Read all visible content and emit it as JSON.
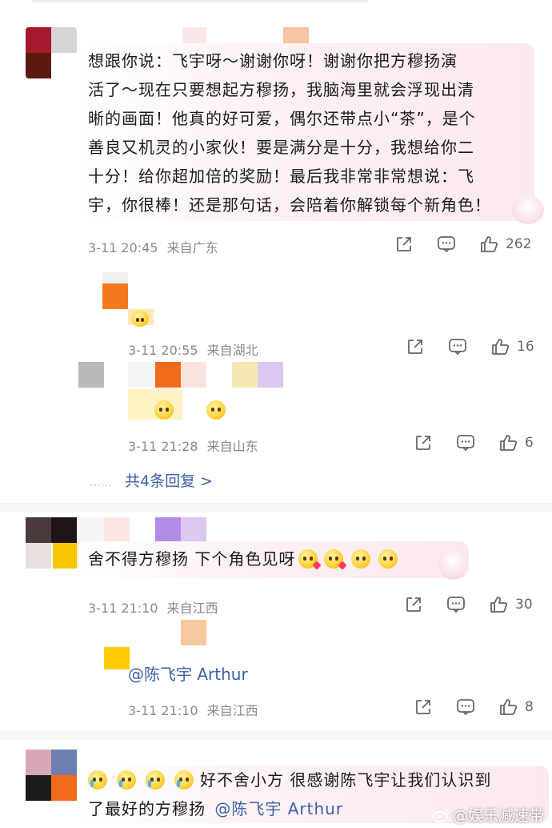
{
  "comment1": {
    "text": "想跟你说：飞宇呀～谢谢你呀！谢谢你把方穆扬演活了～现在只要想起方穆扬，我脑海里就会浮现出清晰的画面！他真的好可爱，偶尔还带点小“茶”，是个善良又机灵的小家伙！要是满分是十分，我想给你二十分！给你超加倍的奖励！最后我非常非常想说：飞宇，你很棒！还是那句话，会陪着你解锁每个新角色！",
    "lines": [
      "想跟你说：飞宇呀～谢谢你呀！谢谢你把方穆扬演",
      "活了～现在只要想起方穆扬，我脑海里就会浮现出清",
      "晰的画面！他真的好可爱，偶尔还带点小“茶”，是个",
      "善良又机灵的小家伙！要是满分是十分，我想给你二",
      "十分！给你超加倍的奖励！最后我非常非常想说：飞",
      "宇，你很棒！还是那句话，会陪着你解锁每个新角色！"
    ],
    "time": "3-11 20:45",
    "location": "来自广东",
    "likes": "262"
  },
  "reply1": {
    "time": "3-11 20:55",
    "location": "来自湖北",
    "likes": "16"
  },
  "reply2": {
    "time": "3-11 21:28",
    "location": "来自山东",
    "likes": "6"
  },
  "more_replies": {
    "dots": "……",
    "label": "共4条回复 >"
  },
  "comment2": {
    "text": "舍不得方穆扬 下个角色见呀",
    "time": "3-11 21:10",
    "location": "来自江西",
    "likes": "30"
  },
  "reply3": {
    "mention": "@陈飞宇 Arthur",
    "time": "3-11 21:10",
    "location": "来自江西",
    "likes": "8"
  },
  "comment3": {
    "text_a": "好不舍小方 很感谢陈飞宇让我们认识到",
    "text_b": "了最好的方穆扬",
    "mention": "@陈飞宇 Arthur"
  },
  "watermark": "@娱乐减速带",
  "icons": {
    "share": "share-icon",
    "comment": "comment-icon",
    "like": "thumbs-up-icon"
  },
  "colors": {
    "link": "#3b5fa8",
    "meta": "#8a8a8a",
    "bubble": "#fbe9ee"
  }
}
